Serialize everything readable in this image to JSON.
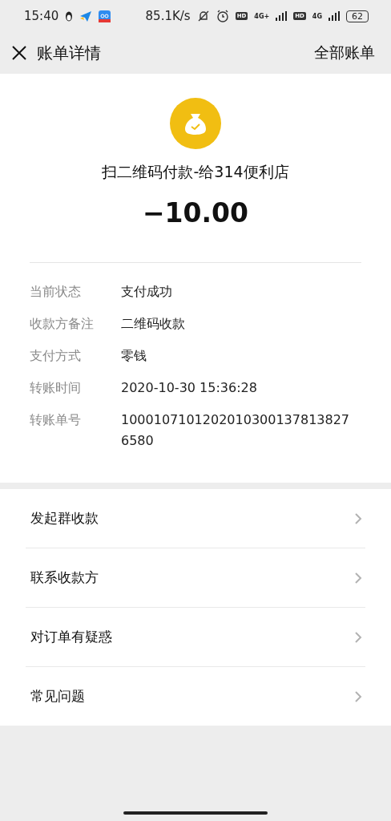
{
  "status_bar": {
    "time": "15:40",
    "speed": "85.1K/s",
    "sim_1": {
      "hd": "HD",
      "network": "4G+"
    },
    "sim_2": {
      "hd": "HD",
      "network": "4G"
    },
    "battery": "62"
  },
  "header": {
    "title": "账单详情",
    "action": "全部账单"
  },
  "summary": {
    "merchant": "扫二维码付款-给314便利店",
    "amount": "−10.00"
  },
  "details": [
    {
      "label": "当前状态",
      "value": "支付成功"
    },
    {
      "label": "收款方备注",
      "value": "二维码收款"
    },
    {
      "label": "支付方式",
      "value": "零钱"
    },
    {
      "label": "转账时间",
      "value": "2020-10-30 15:36:28"
    },
    {
      "label": "转账单号",
      "value": "10001071012020103001378138276580"
    }
  ],
  "actions": [
    {
      "label": "发起群收款"
    },
    {
      "label": "联系收款方"
    },
    {
      "label": "对订单有疑惑"
    },
    {
      "label": "常见问题"
    }
  ]
}
